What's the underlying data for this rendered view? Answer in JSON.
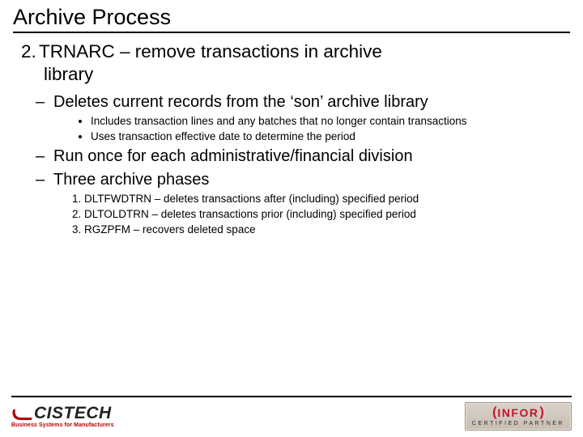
{
  "title": "Archive Process",
  "main": {
    "number": "2.",
    "heading_line1": "TRNARC – remove transactions in archive",
    "heading_line2": "library"
  },
  "points": {
    "p1": "Deletes current records from the ‘son’ archive library",
    "p1_sub1": "Includes transaction lines and any batches that no longer contain transactions",
    "p1_sub2": "Uses transaction effective date to determine the period",
    "p2": "Run once for each administrative/financial division",
    "p3": "Three archive phases",
    "p3_1": "DLTFWDTRN – deletes transactions after (including) specified period",
    "p3_2": "DLTOLDTRN – deletes transactions prior (including) specified period",
    "p3_3": "RGZPFM – recovers deleted space"
  },
  "footer": {
    "left_brand": "CISTECH",
    "left_tag": "Business Systems for Manufacturers",
    "right_brand": "INFOR",
    "right_tag": "CERTIFIED PARTNER"
  }
}
